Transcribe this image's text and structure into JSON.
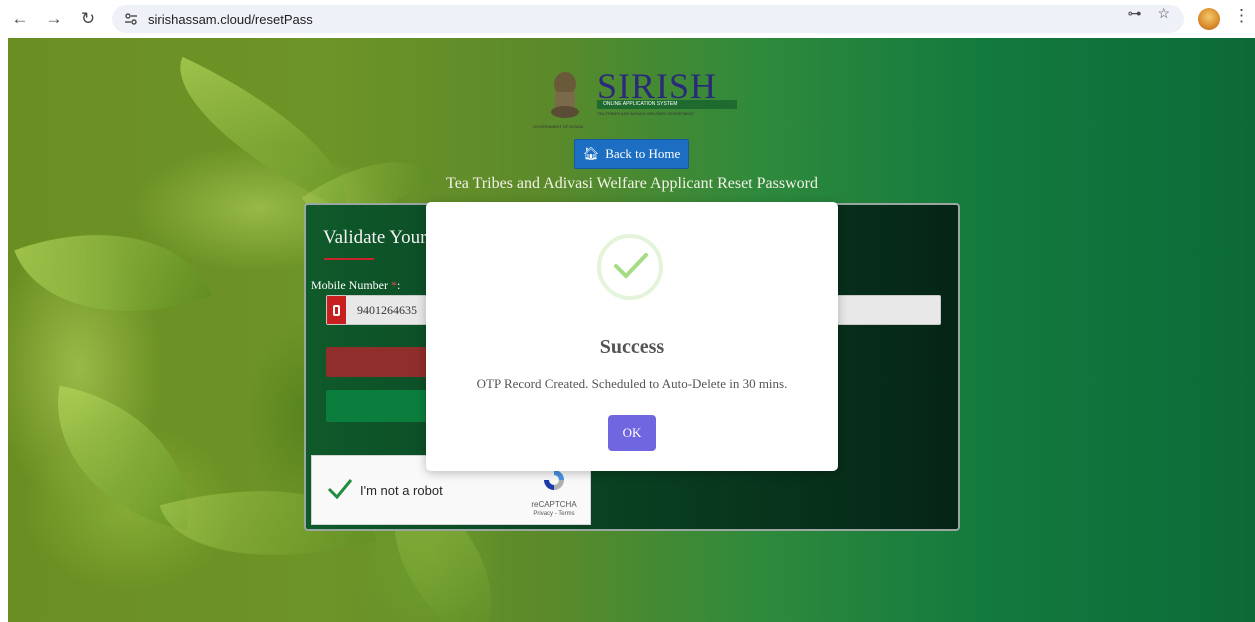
{
  "browser": {
    "url": "sirishassam.cloud/resetPass"
  },
  "header": {
    "logo_title": "SIRISH",
    "logo_subtitle": "ONLINE APPLICATION SYSTEM",
    "logo_department": "TEA TRIBES AND ADIVASI WELFARE DEPARTMENT",
    "logo_government": "GOVERNMENT OF ASSAM",
    "back_button_label": "Back to Home",
    "page_heading": "Tea Tribes and Adivasi Welfare Applicant Reset Password"
  },
  "form": {
    "title": "Validate Your",
    "mobile_label": "Mobile Number",
    "required_mark": "*",
    "mobile_suffix": ":",
    "mobile_value": "9401264635"
  },
  "recaptcha": {
    "label": "I'm not a robot",
    "brand": "reCAPTCHA",
    "links": "Privacy - Terms"
  },
  "modal": {
    "title": "Success",
    "message": "OTP Record Created. Scheduled to Auto-Delete in 30 mins.",
    "ok_label": "OK"
  },
  "colors": {
    "modal_button": "#7066e0",
    "back_button": "#1b6ec2",
    "success_check": "#a5dc86",
    "card_bg": "#0a4423"
  }
}
